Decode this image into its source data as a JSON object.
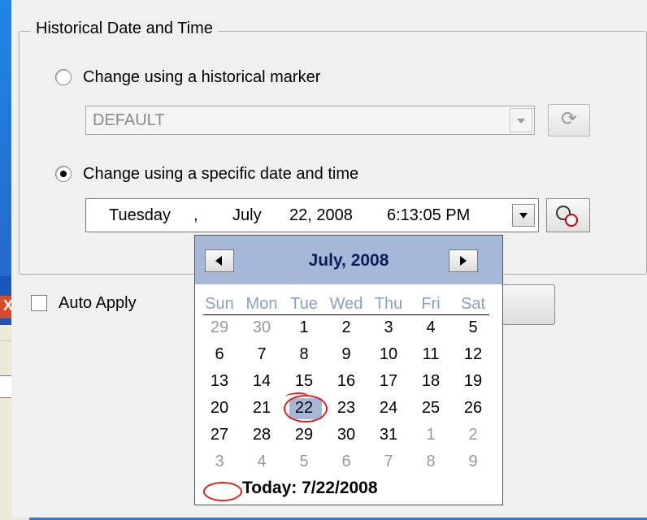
{
  "group": {
    "title": "Historical Date and Time"
  },
  "marker_option": {
    "label": "Change using a historical marker",
    "selected": false
  },
  "marker_combo": {
    "value": "DEFAULT",
    "enabled": false
  },
  "refresh_icon": "refresh-icon",
  "specific_option": {
    "label": "Change using a specific date and time",
    "selected": true
  },
  "date_picker": {
    "weekday": "Tuesday",
    "sep": ",",
    "month": "July",
    "day_year": "22, 2008",
    "time": "6:13:05 PM"
  },
  "clock_icon": "clock-icon",
  "auto_apply": {
    "label": "Auto Apply",
    "checked": false
  },
  "desktop": {
    "close_glyph": "X"
  },
  "calendar": {
    "title": "July, 2008",
    "weekdays": [
      "Sun",
      "Mon",
      "Tue",
      "Wed",
      "Thu",
      "Fri",
      "Sat"
    ],
    "weeks": [
      [
        "29",
        "30",
        "1",
        "2",
        "3",
        "4",
        "5"
      ],
      [
        "6",
        "7",
        "8",
        "9",
        "10",
        "11",
        "12"
      ],
      [
        "13",
        "14",
        "15",
        "16",
        "17",
        "18",
        "19"
      ],
      [
        "20",
        "21",
        "22",
        "23",
        "24",
        "25",
        "26"
      ],
      [
        "27",
        "28",
        "29",
        "30",
        "31",
        "1",
        "2"
      ],
      [
        "3",
        "4",
        "5",
        "6",
        "7",
        "8",
        "9"
      ]
    ],
    "selected_day": "22",
    "today_label": "Today: 7/22/2008",
    "colors": {
      "header": "#a5b8d8",
      "weekday_text": "#8aa0c8",
      "today_ring": "#e0201a"
    }
  }
}
